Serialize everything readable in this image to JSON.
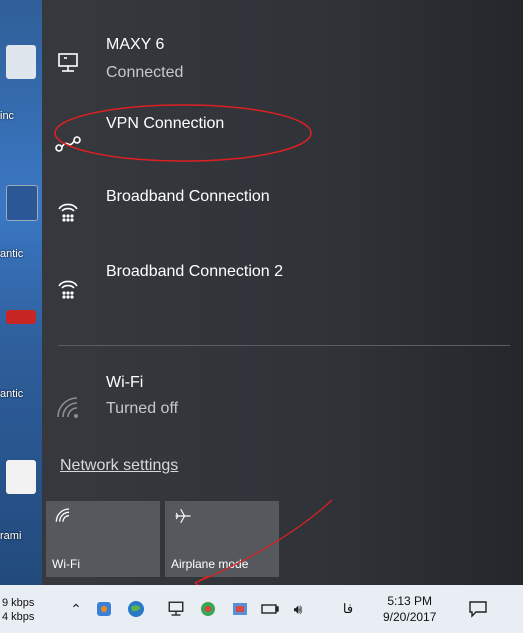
{
  "desktop": {
    "labels": [
      "inc",
      "antic",
      "antic",
      "rami"
    ]
  },
  "networks": [
    {
      "name": "MAXY 6",
      "status": "Connected",
      "icon": "wired-network-icon"
    },
    {
      "name": "VPN Connection",
      "status": "",
      "icon": "vpn-icon"
    },
    {
      "name": "Broadband Connection",
      "status": "",
      "icon": "dialup-icon"
    },
    {
      "name": "Broadband Connection 2",
      "status": "",
      "icon": "dialup-icon"
    }
  ],
  "wifi": {
    "name": "Wi-Fi",
    "status": "Turned off",
    "icon": "wifi-icon"
  },
  "network_settings_label": "Network settings",
  "quick_actions": [
    {
      "label": "Wi-Fi",
      "icon": "wifi-icon"
    },
    {
      "label": "Airplane mode",
      "icon": "airplane-icon"
    }
  ],
  "taskbar": {
    "speed_up": "9 kbps",
    "speed_down": "4 kbps",
    "language": "فا",
    "time": "5:13 PM",
    "date": "9/20/2017"
  },
  "colors": {
    "flyout_bg": "#37393e",
    "tile_bg": "#55585d",
    "annotation": "#e02020",
    "taskbar_bg": "#e9eef5"
  }
}
